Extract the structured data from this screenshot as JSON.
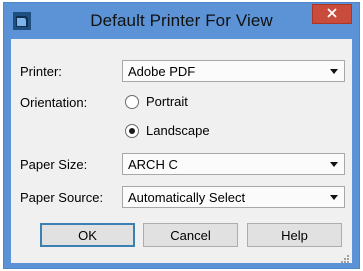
{
  "dialog": {
    "title": "Default Printer For View",
    "icons": {
      "app": "application-logo-icon",
      "close": "close-icon"
    }
  },
  "form": {
    "printer_label": "Printer:",
    "printer_value": "Adobe PDF",
    "orientation_label": "Orientation:",
    "portrait_label": "Portrait",
    "landscape_label": "Landscape",
    "orientation_selected": "Landscape",
    "paper_size_label": "Paper Size:",
    "paper_size_value": "ARCH C",
    "paper_source_label": "Paper Source:",
    "paper_source_value": "Automatically Select"
  },
  "buttons": {
    "ok": "OK",
    "cancel": "Cancel",
    "help": "Help"
  },
  "colors": {
    "titlebar": "#5b93d6",
    "close_button": "#c94b3c",
    "client_background": "#f0f0f0",
    "default_button_border": "#3c7fb1"
  }
}
